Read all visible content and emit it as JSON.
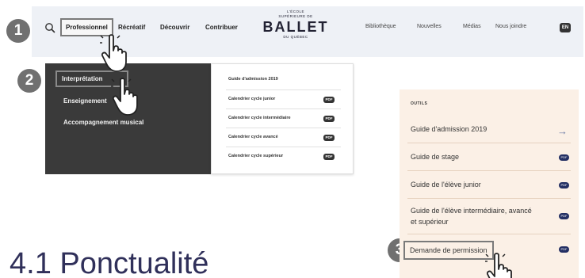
{
  "header": {
    "nav": [
      "Professionnel",
      "Récréatif",
      "Découvrir",
      "Contribuer"
    ],
    "logo": {
      "line1": "L'ÉCOLE",
      "line1b": "SUPÉRIEURE DE",
      "main": "BALLET",
      "line3": "DU QUÉBEC"
    },
    "right_nav": [
      "Bibliothèque",
      "Nouvelles",
      "Médias",
      "Nous joindre"
    ],
    "lang": "EN"
  },
  "steps": [
    "1",
    "2",
    "3"
  ],
  "submenu": [
    "Interprétation",
    "Enseignement",
    "Accompagnement musical"
  ],
  "guides": [
    "Guide d'admission 2019",
    "Calendrier cycle junior",
    "Calendrier cycle intermédiaire",
    "Calendrier cycle avancé",
    "Calendrier cycle supérieur"
  ],
  "pdf_label": "PDF",
  "tools": {
    "label": "OUTILS",
    "items": [
      "Guide d'admission 2019",
      "Guide de stage",
      "Guide de l'élève junior",
      "Guide de l'élève intermédiaire, avancé et supérieur",
      "Demande de permission"
    ],
    "arrow": "→"
  },
  "heading": "4.1 Ponctualité"
}
